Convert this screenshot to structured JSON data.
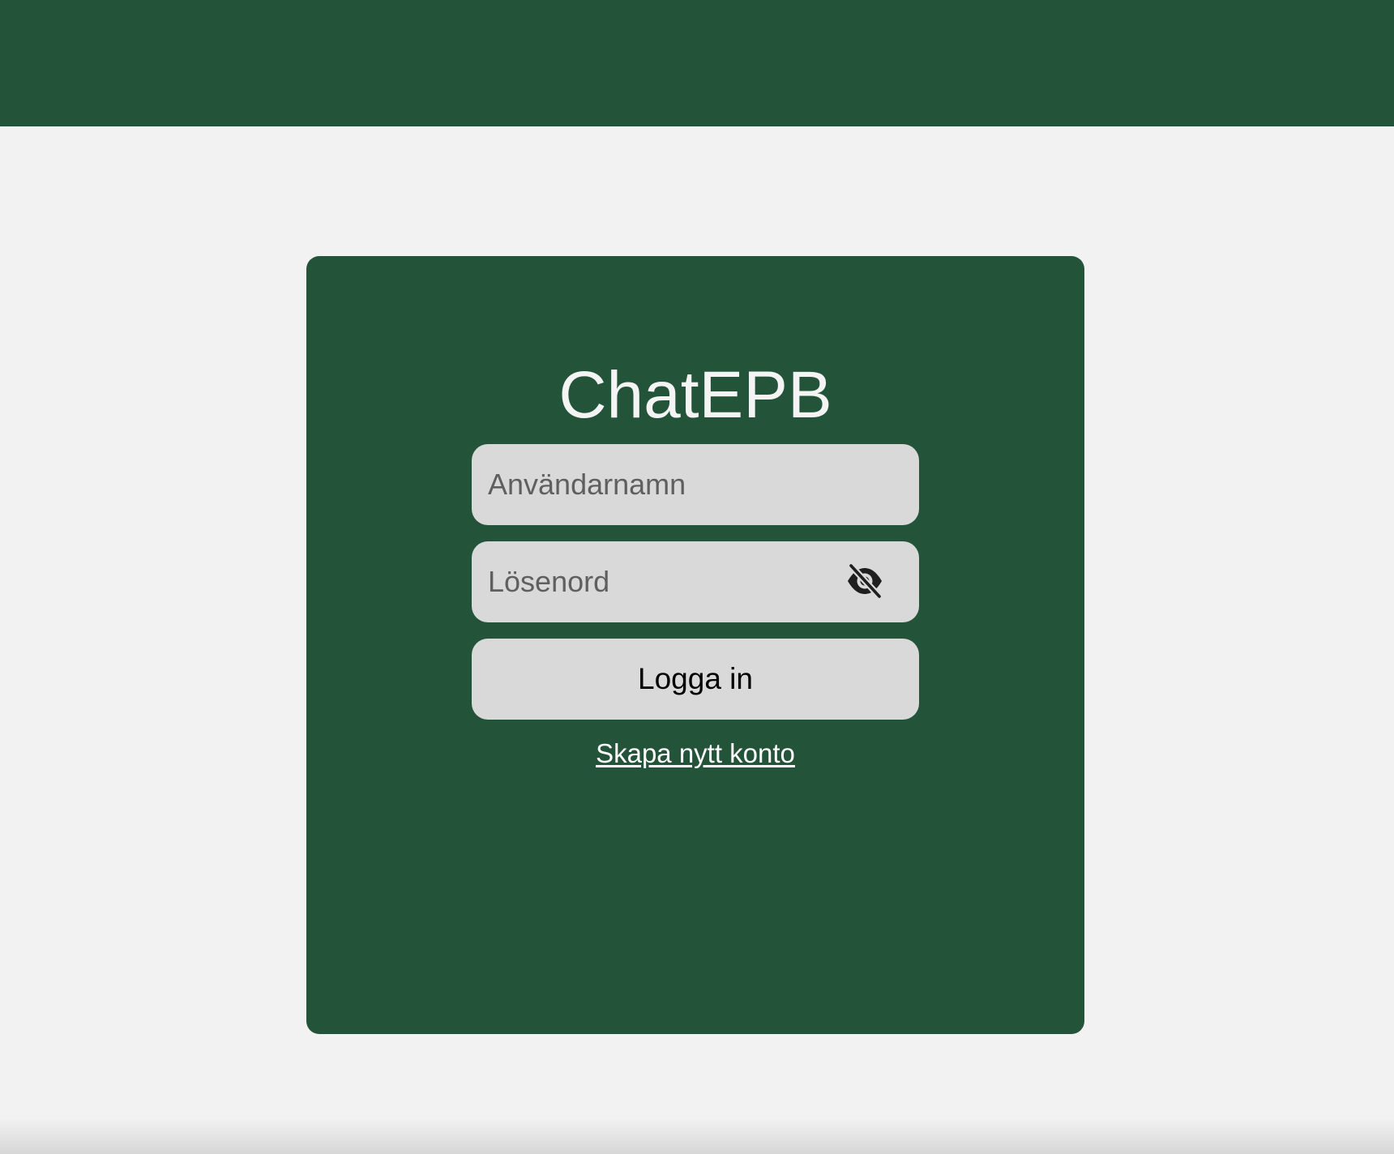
{
  "colors": {
    "brand_green": "#235439",
    "page_background": "#f2f2f2",
    "field_background": "#d9d9d9"
  },
  "login": {
    "title": "ChatEPB",
    "username_placeholder": "Användarnamn",
    "password_placeholder": "Lösenord",
    "password_toggle_icon": "eye-slash-icon",
    "submit_label": "Logga in",
    "create_account_label": "Skapa nytt konto"
  }
}
